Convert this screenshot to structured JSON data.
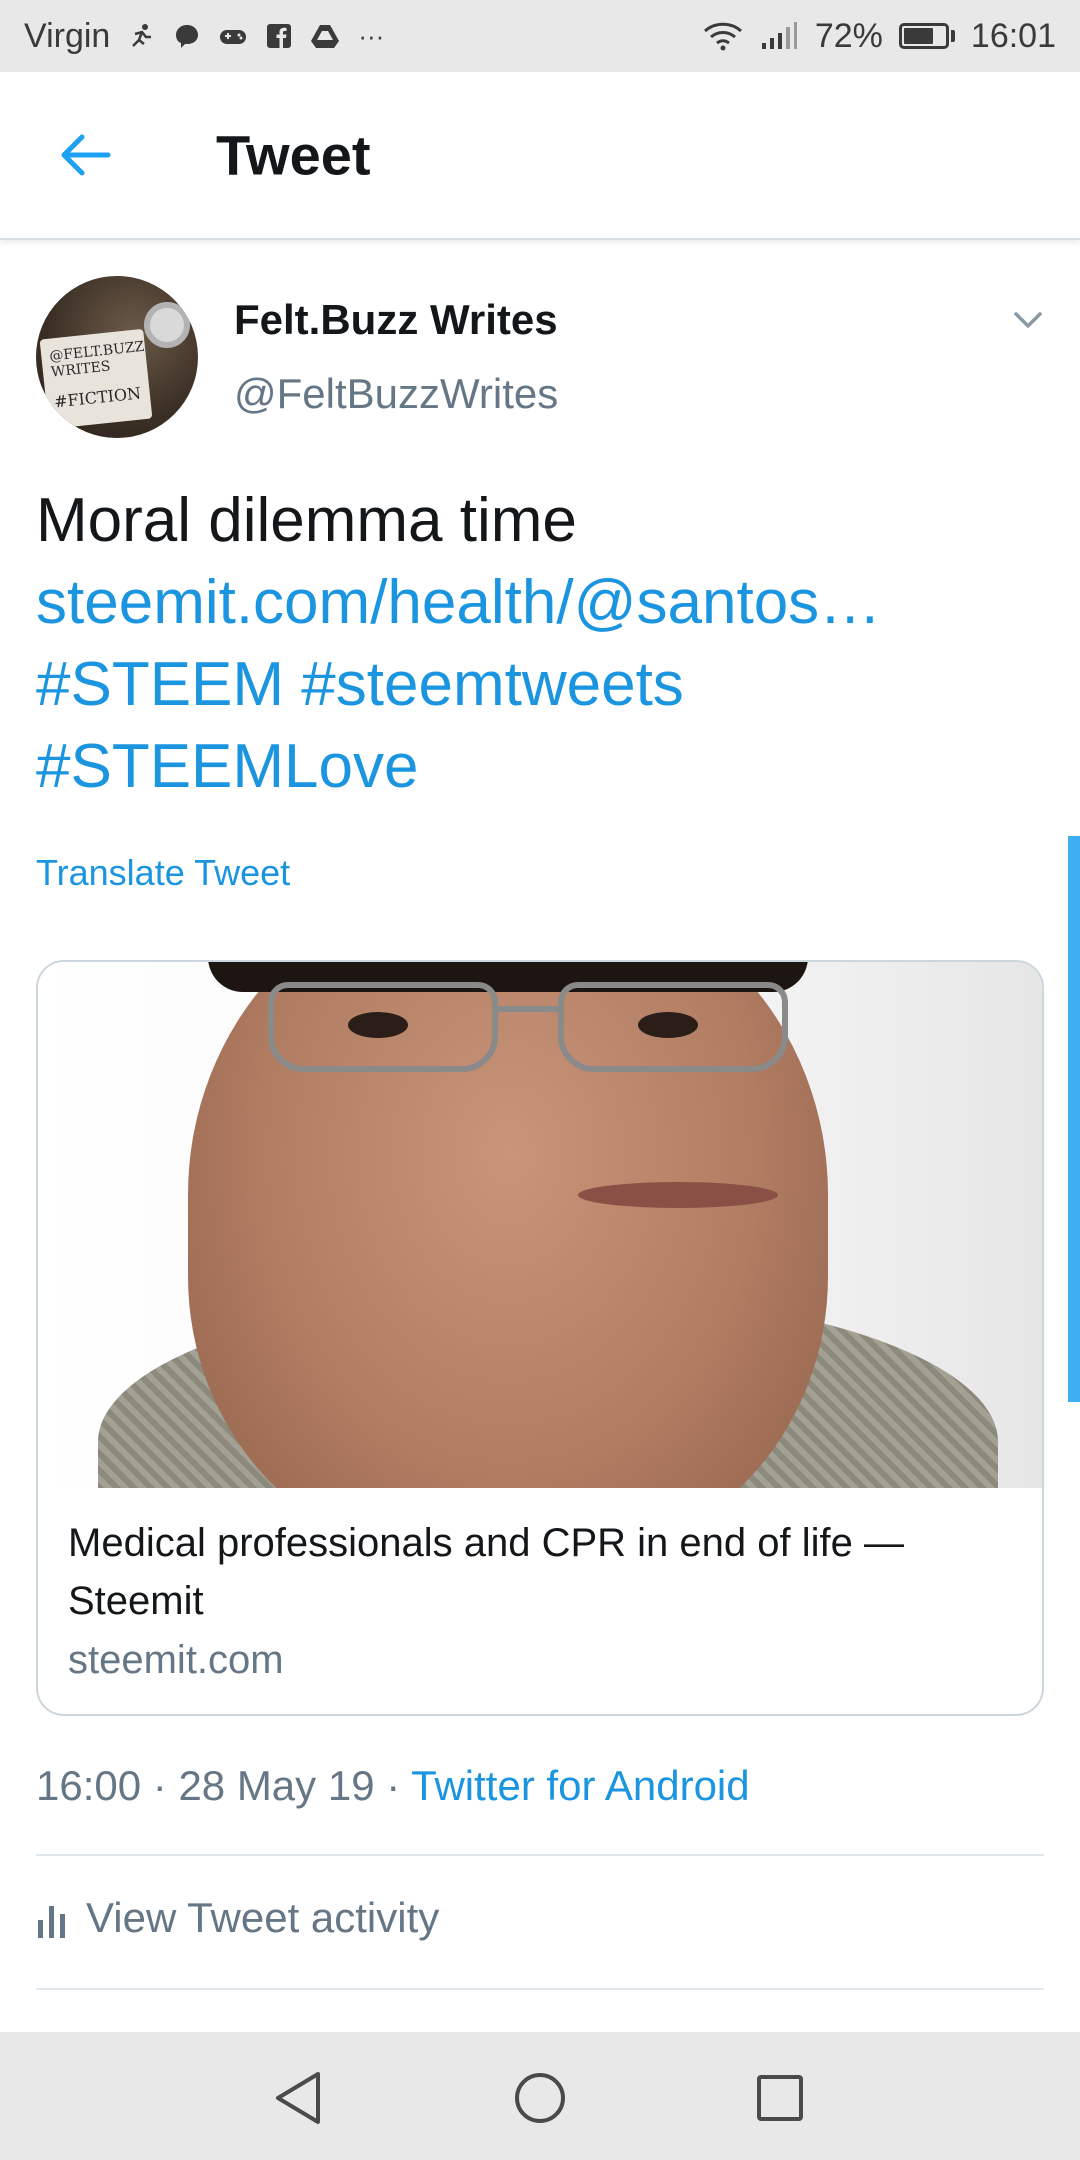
{
  "status_bar": {
    "carrier": "Virgin",
    "overflow": "···",
    "battery_percent": "72%",
    "battery_level": 0.72,
    "time": "16:01",
    "icons": [
      "runner-icon",
      "messenger-icon",
      "game-controller-icon",
      "facebook-icon",
      "drive-icon",
      "wifi-icon",
      "signal-icon",
      "battery-icon"
    ]
  },
  "header": {
    "title": "Tweet",
    "back_icon": "back-arrow-icon"
  },
  "tweet": {
    "display_name": "Felt.Buzz Writes",
    "handle": "@FeltBuzzWrites",
    "avatar_note": [
      "@FELT.BUZZ",
      "WRITES",
      "#FICTION"
    ],
    "text_line1": "Moral dilemma time",
    "link": "steemit.com/health/@santos…",
    "hashtags_line1": "#STEEM #steemtweets",
    "hashtags_line2": "#STEEMLove",
    "translate_label": "Translate Tweet"
  },
  "card": {
    "title": "Medical professionals and CPR in end of life — Steemit",
    "domain": "steemit.com"
  },
  "meta": {
    "time": "16:00",
    "separator": " · ",
    "date": "28 May 19",
    "source": "Twitter for Android"
  },
  "activity": {
    "label": "View Tweet activity"
  },
  "colors": {
    "accent": "#1b95e0",
    "secondary_text": "#657786",
    "primary_text": "#14171a"
  }
}
